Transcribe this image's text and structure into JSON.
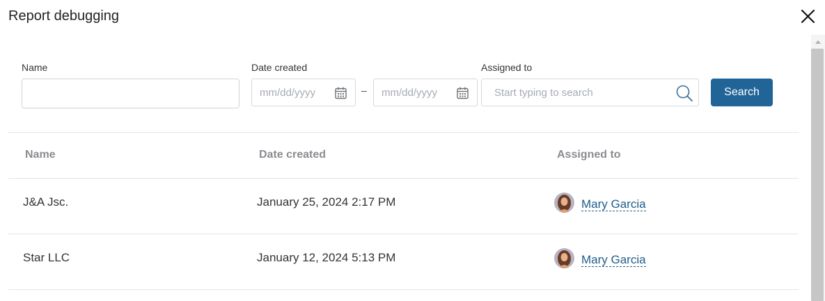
{
  "dialog": {
    "title": "Report debugging"
  },
  "filters": {
    "name_label": "Name",
    "name_value": "",
    "date_label": "Date created",
    "date_from_placeholder": "mm/dd/yyyy",
    "date_separator": "–",
    "date_to_placeholder": "mm/dd/yyyy",
    "assigned_label": "Assigned to",
    "assigned_placeholder": "Start typing to search",
    "search_button": "Search"
  },
  "table": {
    "headers": [
      "Name",
      "Date created",
      "Assigned to"
    ],
    "rows": [
      {
        "name": "J&A Jsc.",
        "date": "January 25, 2024 2:17 PM",
        "assigned": "Mary Garcia"
      },
      {
        "name": "Star LLC",
        "date": "January 12, 2024 5:13 PM",
        "assigned": "Mary Garcia"
      }
    ]
  },
  "colors": {
    "accent": "#216598",
    "link": "#1f5c8a",
    "header_text": "#8a8d91"
  },
  "icons": {
    "close": "close-icon",
    "calendar": "calendar-icon",
    "search": "search-icon",
    "avatar": "user-avatar"
  }
}
